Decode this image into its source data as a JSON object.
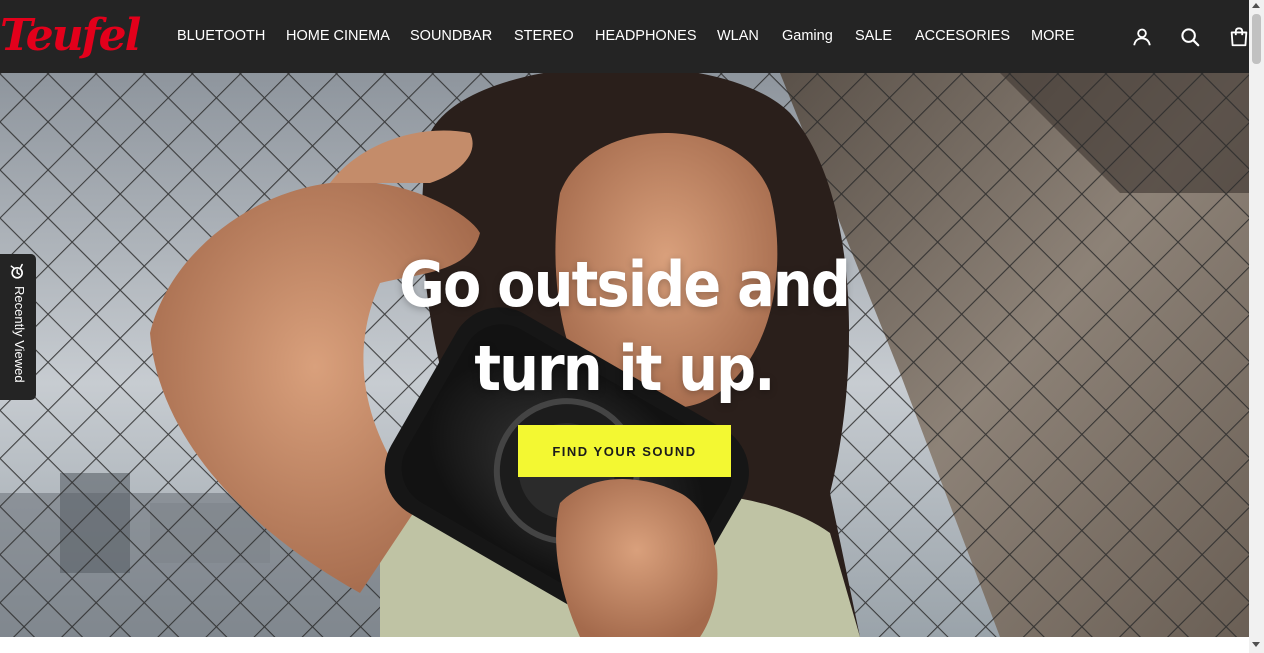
{
  "brand": {
    "logo_text": "Teufel",
    "logo_color": "#e3001b"
  },
  "nav": {
    "items": [
      {
        "label": "BLUETOOTH"
      },
      {
        "label": "HOME CINEMA"
      },
      {
        "label": "SOUNDBAR"
      },
      {
        "label": "STEREO"
      },
      {
        "label": "HEADPHONES"
      },
      {
        "label": "WLAN"
      },
      {
        "label": "Gaming"
      },
      {
        "label": "SALE"
      },
      {
        "label": "ACCESORIES"
      },
      {
        "label": "MORE"
      }
    ]
  },
  "header_icons": [
    "account-icon",
    "search-icon",
    "cart-icon"
  ],
  "hero": {
    "headline_line1": "Go outside and",
    "headline_line2": "turn it up.",
    "cta_label": "FIND YOUR SOUND",
    "cta_color": "#f3f832"
  },
  "recently_viewed": {
    "label": "Recently Viewed"
  },
  "colors": {
    "header_bg": "#242424",
    "text_on_dark": "#ffffff"
  }
}
